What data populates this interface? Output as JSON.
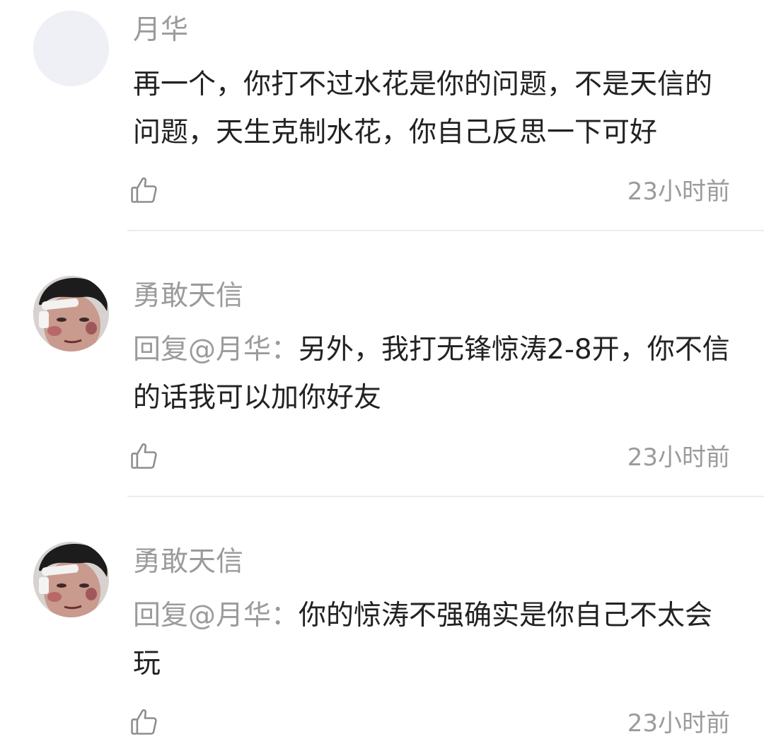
{
  "comments": [
    {
      "username": "月华",
      "avatar": "blank",
      "mention": "",
      "text": "再一个，你打不过水花是你的问题，不是天信的问题，天生克制水花，你自己反思一下可好",
      "time": "23小时前",
      "like_icon": "thumbs-up-outline"
    },
    {
      "username": "勇敢天信",
      "avatar": "photo",
      "mention": "回复@月华：",
      "text": "另外，我打无锋惊涛2-8开，你不信的话我可以加你好友",
      "time": "23小时前",
      "like_icon": "thumbs-up-outline"
    },
    {
      "username": "勇敢天信",
      "avatar": "photo",
      "mention": "回复@月华：",
      "text": "你的惊涛不强确实是你自己不太会玩",
      "time": "23小时前",
      "like_icon": "thumbs-up-outline"
    }
  ],
  "colors": {
    "name": "#9b9b9b",
    "text": "#222222",
    "divider": "#ececec",
    "avatar_blank": "#efeff6"
  }
}
